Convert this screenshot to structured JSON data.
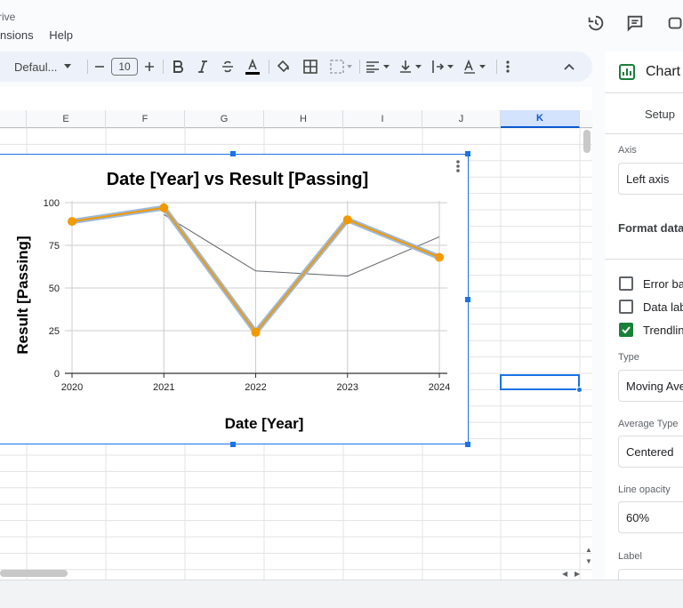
{
  "app": {
    "title_fragment": "rive"
  },
  "menu": [
    "nsions",
    "Help"
  ],
  "toolbar": {
    "font_name": "Defaul...",
    "font_size": "10"
  },
  "sheet": {
    "columns": [
      "E",
      "F",
      "G",
      "H",
      "I",
      "J",
      "K"
    ],
    "selected_column": "K"
  },
  "chart_data": {
    "type": "line",
    "title": "Date [Year] vs Result [Passing]",
    "xlabel": "Date [Year]",
    "ylabel": "Result [Passing]",
    "categories": [
      "2020",
      "2021",
      "2022",
      "2023",
      "2024"
    ],
    "series": [
      {
        "values": [
          89,
          97,
          24,
          90,
          68
        ],
        "color": "#f29900"
      }
    ],
    "trendline": {
      "type": "moving_average",
      "values": [
        null,
        93,
        60,
        57,
        80
      ],
      "color": "#5f6368"
    },
    "yticks": [
      0,
      25,
      50,
      75,
      100
    ],
    "ylim": [
      0,
      100
    ],
    "grid": true,
    "legend": "none"
  },
  "panel": {
    "title": "Chart",
    "tab_setup": "Setup",
    "axis_label": "Axis",
    "axis_value": "Left axis",
    "format_data_label": "Format data",
    "checkboxes": [
      {
        "label": "Error ba",
        "checked": false
      },
      {
        "label": "Data lab",
        "checked": false
      },
      {
        "label": "Trendlin",
        "checked": true
      }
    ],
    "type_label": "Type",
    "type_value": "Moving Ave",
    "average_type_label": "Average Type",
    "average_type_value": "Centered",
    "line_opacity_label": "Line opacity",
    "line_opacity_value": "60%",
    "label_label": "Label"
  },
  "colors": {
    "accent": "#1a73e8",
    "series": "#f29900",
    "trendline": "#5f6368",
    "check": "#188038"
  }
}
